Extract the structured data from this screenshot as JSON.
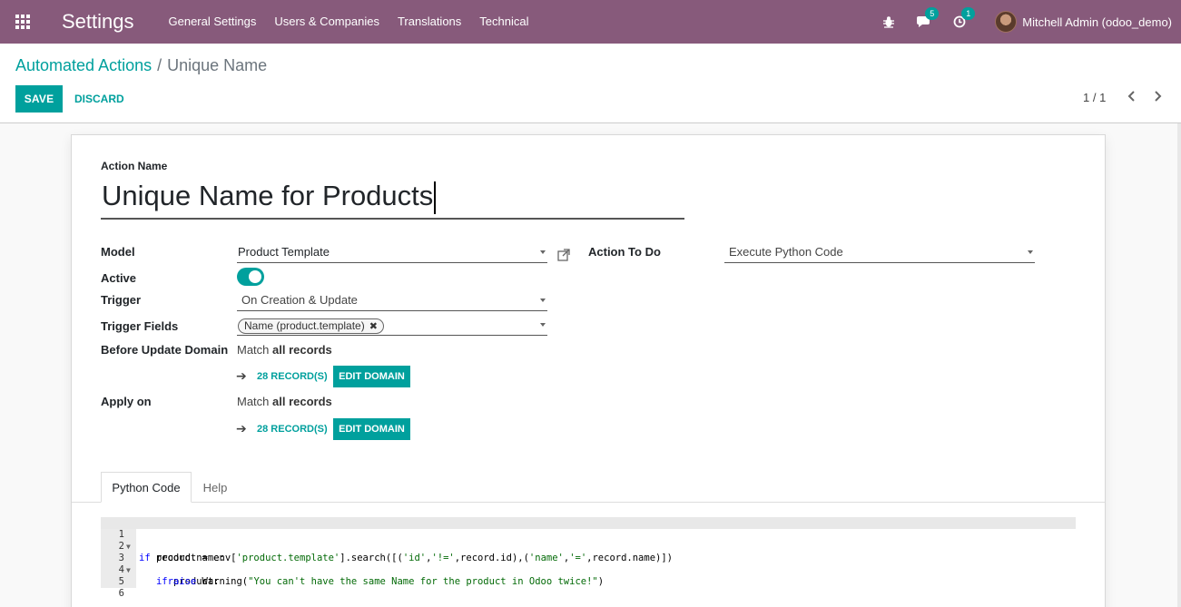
{
  "navbar": {
    "app_title": "Settings",
    "menus": [
      "General Settings",
      "Users & Companies",
      "Translations",
      "Technical"
    ],
    "messages_count": "5",
    "activities_count": "1",
    "user_name": "Mitchell Admin (odoo_demo)"
  },
  "breadcrumb": {
    "parent": "Automated Actions",
    "separator": "/",
    "current": "Unique Name"
  },
  "buttons": {
    "save": "SAVE",
    "discard": "DISCARD"
  },
  "pager": {
    "value": "1 / 1"
  },
  "form": {
    "action_name_label": "Action Name",
    "action_name_value": "Unique Name for Products",
    "model_label": "Model",
    "model_value": "Product Template",
    "action_to_do_label": "Action To Do",
    "action_to_do_value": "Execute Python Code",
    "active_label": "Active",
    "active_value": true,
    "trigger_label": "Trigger",
    "trigger_value": "On Creation & Update",
    "trigger_fields_label": "Trigger Fields",
    "trigger_fields_tags": [
      "Name (product.template)"
    ],
    "before_update_domain_label": "Before Update Domain",
    "before_match_prefix": "Match",
    "before_match_bold": "all records",
    "before_records": "28 RECORD(S)",
    "before_edit_domain": "EDIT DOMAIN",
    "apply_on_label": "Apply on",
    "apply_match_prefix": "Match",
    "apply_match_bold": "all records",
    "apply_records": "28 RECORD(S)",
    "apply_edit_domain": "EDIT DOMAIN"
  },
  "tabs": [
    {
      "label": "Python Code",
      "active": true
    },
    {
      "label": "Help",
      "active": false
    }
  ],
  "code_editor": {
    "lines": [
      {
        "num": "1",
        "fold": true
      },
      {
        "num": "2",
        "fold": false
      },
      {
        "num": "3",
        "fold": true
      },
      {
        "num": "4",
        "fold": false
      },
      {
        "num": "5",
        "fold": false
      },
      {
        "num": "6",
        "fold": false
      }
    ],
    "code_text": [
      "if record.name:",
      "    product = env['product.template'].search([('id','!=',record.id),('name','=',record.name)])",
      "    if product:",
      "      raise Warning(\"You can't have the same Name for the product in Odoo twice!\")",
      "",
      ""
    ]
  },
  "colors": {
    "navbar": "#875a7b",
    "accent": "#00a09d"
  }
}
